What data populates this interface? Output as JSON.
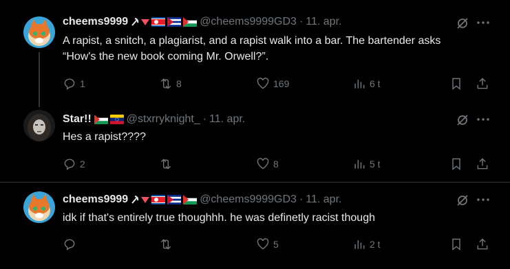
{
  "posts": [
    {
      "name": "cheems9999",
      "handle": "@cheems9999GD3",
      "separator": "·",
      "date": "11. apr.",
      "text": "A rapist, a snitch, a plagiarist, and a rapist walk into a bar. The bartender asks “How's the new book coming Mr. Orwell?”.",
      "replies": "1",
      "reposts": "8",
      "likes": "169",
      "views": "6 t"
    },
    {
      "name": "Star!!",
      "handle": "@stxrryknight_",
      "separator": "·",
      "date": "11. apr.",
      "text": "Hes a rapist????",
      "replies": "2",
      "reposts": "",
      "likes": "8",
      "views": "5 t"
    },
    {
      "name": "cheems9999",
      "handle": "@cheems9999GD3",
      "separator": "·",
      "date": "11. apr.",
      "text": "idk if that's entirely true thoughhh. he was definetly racist though",
      "replies": "",
      "reposts": "",
      "likes": "5",
      "views": "2 t"
    }
  ],
  "icons": {
    "reply": "reply-icon",
    "repost": "repost-icon",
    "like": "heart-icon",
    "views": "views-icon",
    "bookmark": "bookmark-icon",
    "share": "share-icon",
    "grok": "grok-icon",
    "more": "more-icon"
  },
  "colors": {
    "background": "#000000",
    "text": "#e7e9ea",
    "muted": "#71767b",
    "thread": "#333639"
  }
}
